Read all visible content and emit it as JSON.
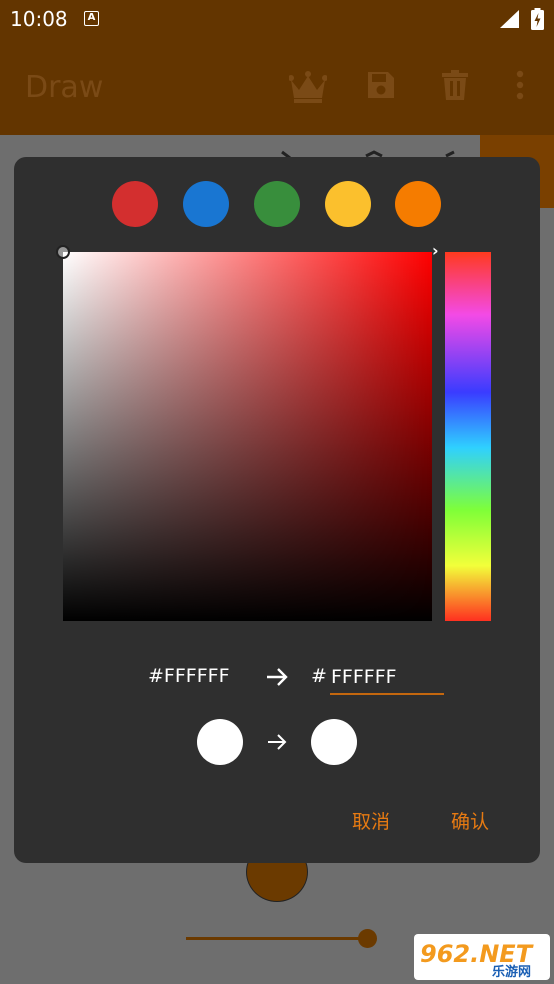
{
  "status_bar": {
    "time": "10:08",
    "notification_letter": "A"
  },
  "app_bar": {
    "title": "Draw"
  },
  "dialog": {
    "presets": [
      {
        "name": "red",
        "color": "#d32f2f"
      },
      {
        "name": "blue",
        "color": "#1976d2"
      },
      {
        "name": "green",
        "color": "#388e3c"
      },
      {
        "name": "yellow",
        "color": "#fbc02d"
      },
      {
        "name": "orange",
        "color": "#f57c00"
      }
    ],
    "hue_color": "#ff0000",
    "old_hex": "#FFFFFF",
    "hex_prefix": "#",
    "hex_value": "FFFFFF",
    "old_color": "#ffffff",
    "new_color": "#ffffff",
    "cancel_label": "取消",
    "confirm_label": "确认"
  },
  "watermark": {
    "text": "962.NET",
    "subtext": "乐游网"
  },
  "colors": {
    "app_bar": "#633500",
    "accent": "#e67a12"
  }
}
